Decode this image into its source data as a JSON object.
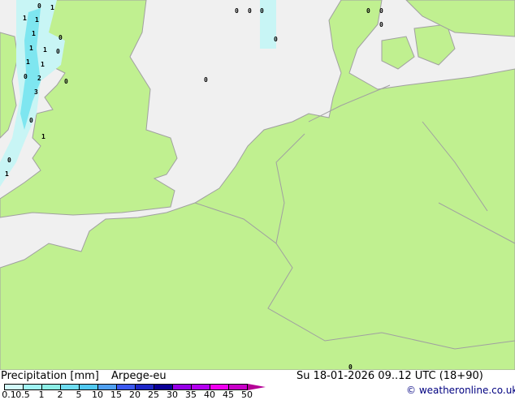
{
  "title": "Precipitation [mm]",
  "model": "Arpege-eu",
  "datetime": "Su 18-01-2026 09..12 UTC (18+90)",
  "copyright": "© weatheronline.co.uk",
  "colors": {
    "sea": "#f0f0f0",
    "land": "#c0f090",
    "border": "#a0a0a0",
    "rain_light": "#c8f5f5",
    "rain_mid": "#7ee6f0"
  },
  "legend": {
    "ticks": [
      "0.1",
      "0.5",
      "1",
      "2",
      "5",
      "10",
      "15",
      "20",
      "25",
      "30",
      "35",
      "40",
      "45",
      "50"
    ],
    "colors": [
      "#d2fafa",
      "#a0f5f5",
      "#8ceee6",
      "#6edcf0",
      "#50c8f0",
      "#50a0f0",
      "#3c5af0",
      "#1e28c8",
      "#0a0096",
      "#9600e6",
      "#b400f0",
      "#f000f0",
      "#c800c8"
    ],
    "overflow_color": "#b40096"
  },
  "map_labels": [
    "0",
    "1",
    "1",
    "1",
    "1",
    "1",
    "0",
    "1",
    "0",
    "1",
    "1",
    "0",
    "2",
    "3",
    "0",
    "0",
    "1",
    "0",
    "1",
    "0",
    "0",
    "0",
    "0",
    "0",
    "0",
    "0",
    "0",
    "0"
  ]
}
